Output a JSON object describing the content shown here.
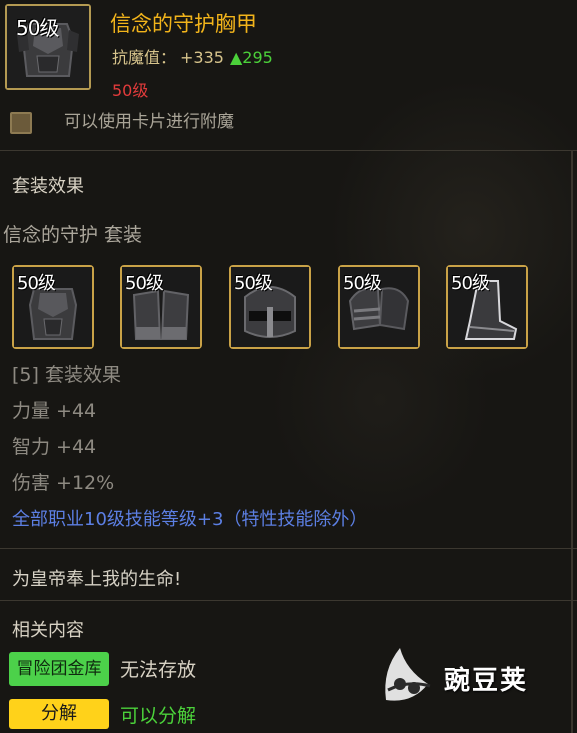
{
  "item": {
    "level": "50级",
    "name": "信念的守护胸甲",
    "stat_label": "抗魔值：",
    "stat_value": "+335",
    "stat_increase": "▲295",
    "required_level": "50级",
    "icon": "chest-armor-icon"
  },
  "enchant": {
    "text": "可以使用卡片进行附魔"
  },
  "set_section": {
    "title": "套装效果",
    "set_name": "信念的守护  套装",
    "pieces": [
      {
        "level": "50级",
        "icon": "chest-armor-icon"
      },
      {
        "level": "50级",
        "icon": "leg-armor-icon"
      },
      {
        "level": "50级",
        "icon": "helmet-icon"
      },
      {
        "level": "50级",
        "icon": "shoulder-armor-icon"
      },
      {
        "level": "50级",
        "icon": "boots-icon"
      }
    ],
    "effect_header": "[5] 套装效果",
    "effects": [
      "力量 +44",
      "智力 +44",
      "伤害 +12%"
    ],
    "skill_line": "全部职业10级技能等级+3（特性技能除外）"
  },
  "flavor_text": "为皇帝奉上我的生命!",
  "related": {
    "title": "相关内容",
    "storage_badge": "冒险团金库",
    "storage_text": "无法存放",
    "split_badge": "分解",
    "split_text": "可以分解"
  },
  "watermark": {
    "text": "豌豆荚",
    "icon": "pea-pod-logo-icon"
  },
  "colors": {
    "item_name": "#f2b41b",
    "stat_up": "#4bd13a",
    "required_level": "#e23b3b",
    "skill_line": "#5c7fe3",
    "slot_border": "#c9a247",
    "green_badge": "#4cd14a",
    "yellow_badge": "#ffd21a"
  }
}
